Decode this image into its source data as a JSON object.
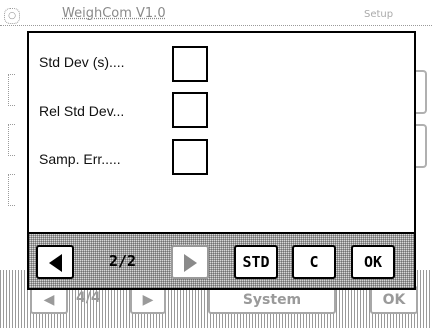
{
  "background": {
    "app_title": "WeighCom V1.0",
    "menu_label": "Setup",
    "footer": {
      "page_indicator": "4/4",
      "system_label": "System",
      "ok_label": "OK"
    }
  },
  "dialog": {
    "rows": [
      {
        "label": "Std Dev (s)....",
        "checked": false
      },
      {
        "label": "Rel Std Dev...",
        "checked": false
      },
      {
        "label": "Samp. Err.....",
        "checked": false
      }
    ],
    "toolbar": {
      "page_indicator": "2/2",
      "std_label": "STD",
      "c_label": "C",
      "ok_label": "OK"
    }
  },
  "icons": {
    "prev": "triangle-left-icon",
    "next": "triangle-right-icon"
  }
}
